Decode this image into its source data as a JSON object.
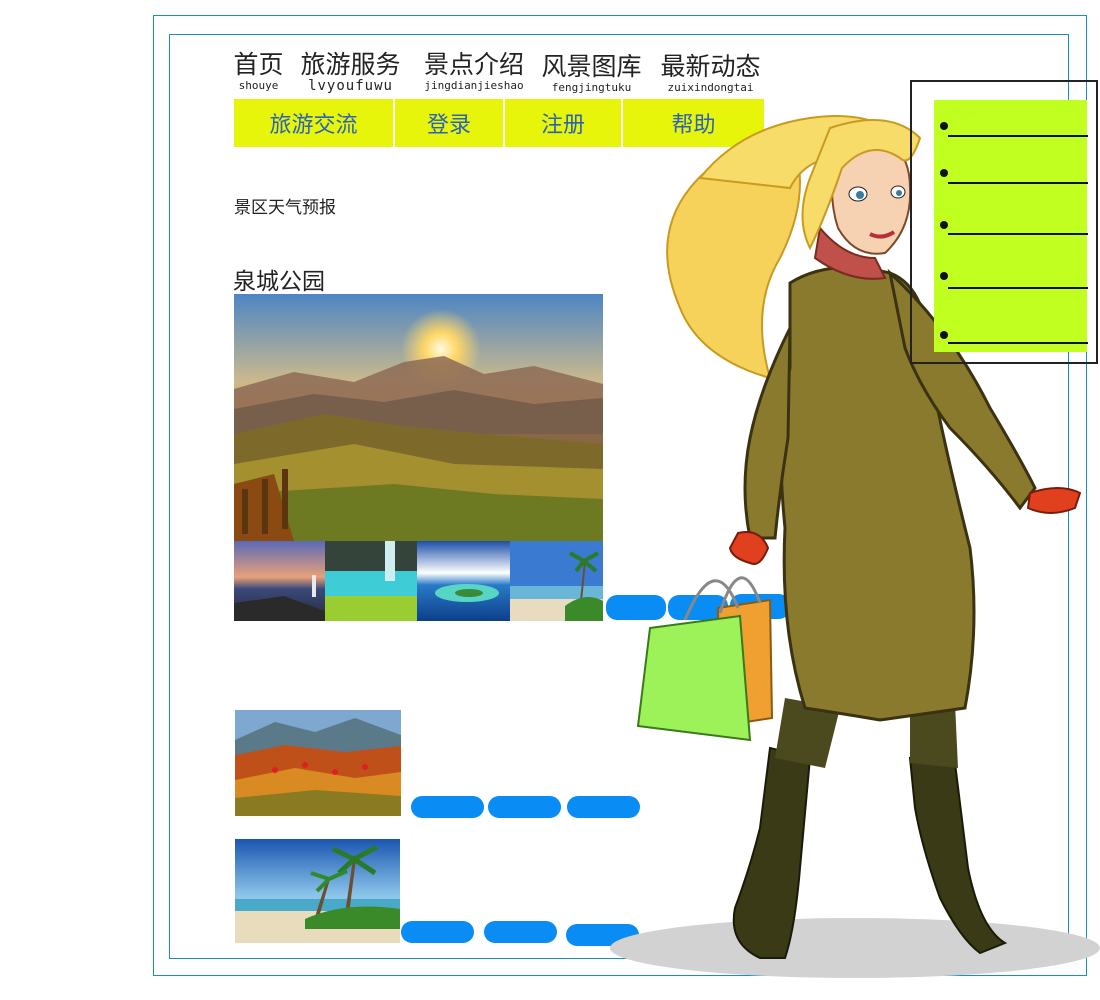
{
  "nav": {
    "items": [
      {
        "label": "首页",
        "pinyin": "shouye"
      },
      {
        "label": "旅游服务",
        "pinyin": "lvyoufuwu"
      },
      {
        "label": "景点介绍",
        "pinyin": "jingdianjieshao"
      },
      {
        "label": "风景图库",
        "pinyin": "fengjingtuku"
      },
      {
        "label": "最新动态",
        "pinyin": "zuixindongtai"
      }
    ]
  },
  "subnav": {
    "items": [
      "旅游交流",
      "登录",
      "注册",
      "帮助"
    ]
  },
  "weather": {
    "label": "景区天气预报"
  },
  "park": {
    "title": "泉城公园"
  },
  "colors": {
    "frame": "#1a8fc2",
    "subnav_bg": "#e6f50a",
    "subnav_text": "#2a63b8",
    "pill": "#0a8cf5",
    "side_panel": "#c1ff20"
  },
  "images": {
    "main": "mountain-sunset-photo",
    "thumbnails": [
      "lighthouse-sunset-thumb",
      "lake-waterfall-thumb",
      "tropical-island-thumb",
      "palm-beach-thumb"
    ],
    "gallery": [
      "autumn-hills-photo",
      "palm-beach-photo"
    ],
    "illustration": "woman-shopping-illustration"
  }
}
